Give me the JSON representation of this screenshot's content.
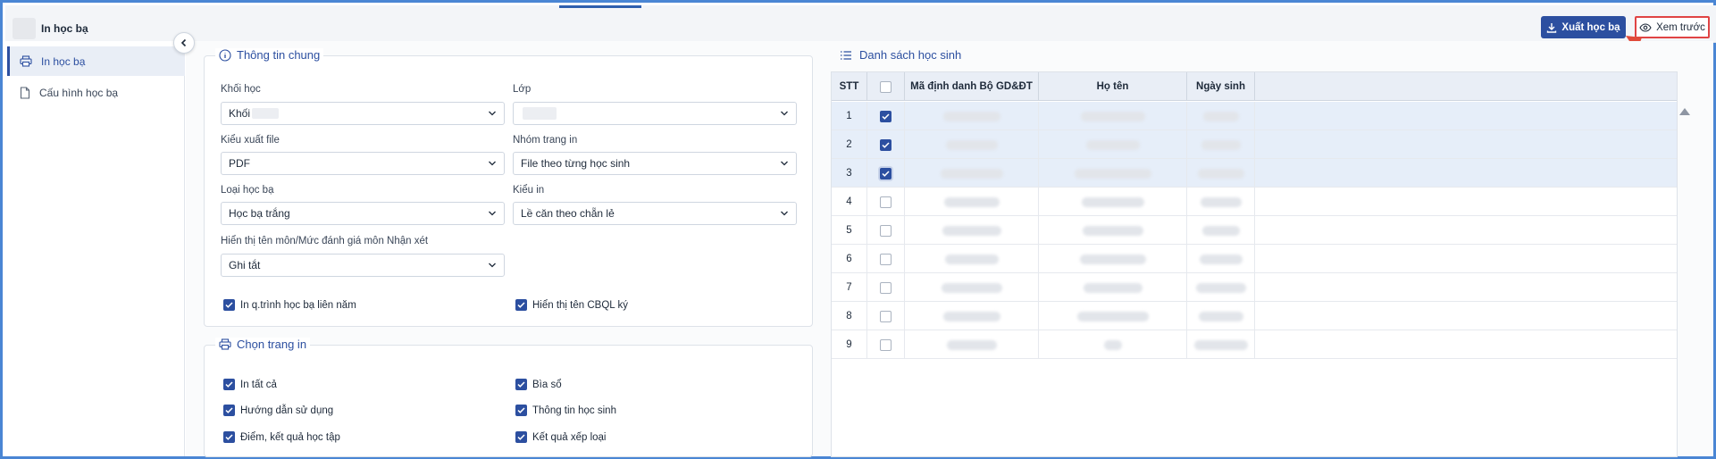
{
  "app": {
    "title": "In học bạ"
  },
  "toolbar": {
    "export_label": "Xuất học bạ",
    "preview_label": "Xem trước"
  },
  "sidebar": {
    "items": [
      {
        "label": "In học bạ",
        "icon": "printer-icon",
        "active": true
      },
      {
        "label": "Cấu hình học bạ",
        "icon": "document-icon",
        "active": false
      }
    ]
  },
  "general": {
    "title": "Thông tin chung",
    "grade": {
      "label": "Khối học",
      "value": "Khối"
    },
    "class": {
      "label": "Lớp",
      "value": ""
    },
    "file_type": {
      "label": "Kiểu xuất file",
      "value": "PDF"
    },
    "print_group": {
      "label": "Nhóm trang in",
      "value": "File theo từng học sinh"
    },
    "record_type": {
      "label": "Loại học bạ",
      "value": "Học bạ trắng"
    },
    "print_style": {
      "label": "Kiểu in",
      "value": "Lề căn theo chẵn lẻ"
    },
    "display_mode": {
      "label": "Hiển thị tên môn/Mức đánh giá môn Nhận xét",
      "value": "Ghi tắt"
    },
    "options": [
      {
        "label": "In q.trình học bạ liên năm",
        "checked": true
      },
      {
        "label": "Hiển thị tên CBQL ký",
        "checked": true
      }
    ]
  },
  "pages": {
    "title": "Chọn trang in",
    "items": [
      {
        "label": "In tất cả",
        "checked": true
      },
      {
        "label": "Bìa sổ",
        "checked": true
      },
      {
        "label": "Hướng dẫn sử dụng",
        "checked": true
      },
      {
        "label": "Thông tin học sinh",
        "checked": true
      },
      {
        "label": "Điểm, kết quả học tập",
        "checked": true
      },
      {
        "label": "Kết quả xếp loại",
        "checked": true
      }
    ]
  },
  "students": {
    "title": "Danh sách học sinh",
    "columns": [
      "STT",
      "",
      "Mã định danh Bộ GD&ĐT",
      "Họ tên",
      "Ngày sinh"
    ],
    "rows": [
      {
        "stt": "1",
        "checked": true
      },
      {
        "stt": "2",
        "checked": true
      },
      {
        "stt": "3",
        "checked": true
      },
      {
        "stt": "4",
        "checked": false
      },
      {
        "stt": "5",
        "checked": false
      },
      {
        "stt": "6",
        "checked": false
      },
      {
        "stt": "7",
        "checked": false
      },
      {
        "stt": "8",
        "checked": false
      },
      {
        "stt": "9",
        "checked": false
      }
    ]
  },
  "colors": {
    "primary": "#2c4fa0",
    "highlight": "#e04444",
    "selected_row": "#e6eef9"
  }
}
